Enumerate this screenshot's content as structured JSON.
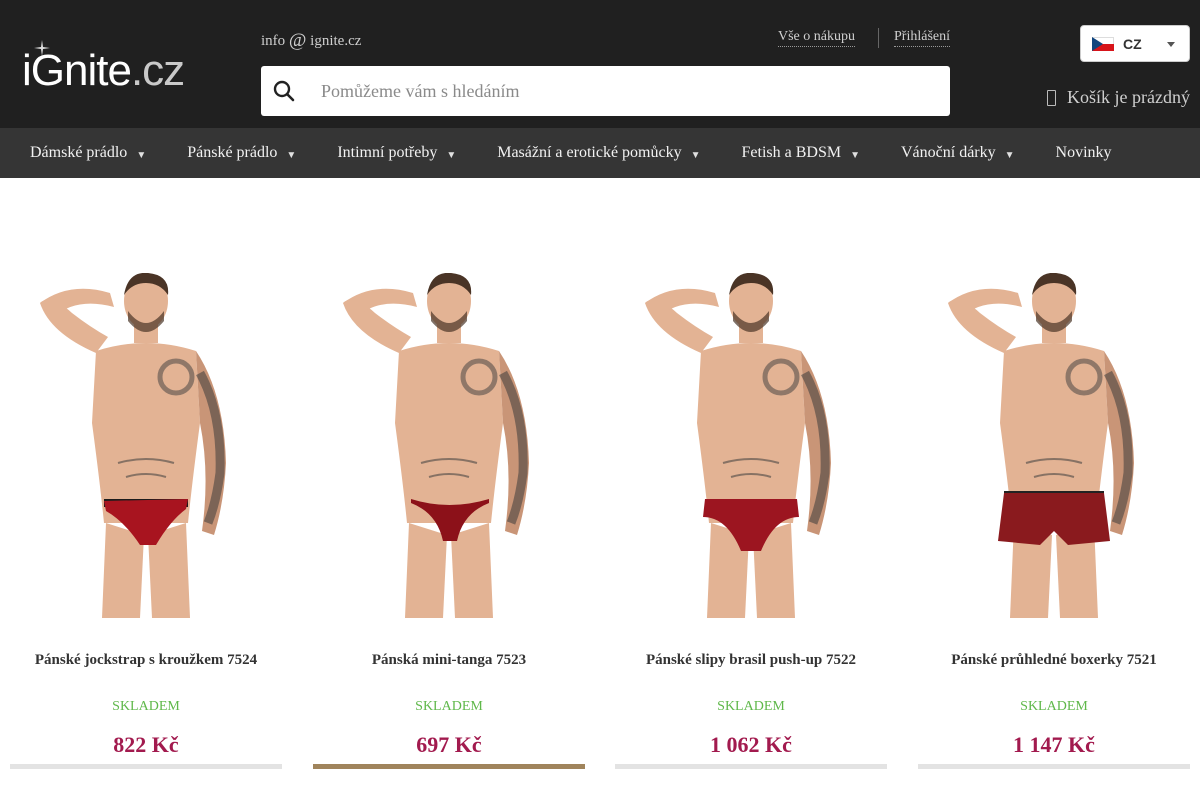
{
  "brand": {
    "logo_main": "iGnite",
    "logo_tld": ".cz"
  },
  "header": {
    "email_user": "info",
    "email_at": "@",
    "email_domain": "ignite.cz",
    "links": {
      "about": "Vše o nákupu",
      "login": "Přihlášení"
    },
    "language": {
      "code": "CZ"
    },
    "search": {
      "placeholder": "Pomůžeme vám s hledáním"
    },
    "cart": {
      "label": "Košík je prázdný"
    }
  },
  "nav": {
    "items": [
      {
        "label": "Dámské prádlo",
        "caret": "▼"
      },
      {
        "label": "Pánské prádlo",
        "caret": "▼"
      },
      {
        "label": "Intimní potřeby",
        "caret": "▼"
      },
      {
        "label": "Masážní a erotické pomůcky",
        "caret": "▼"
      },
      {
        "label": "Fetish a BDSM",
        "caret": "▼"
      },
      {
        "label": "Vánoční dárky",
        "caret": "▼"
      },
      {
        "label": "Novinky"
      }
    ]
  },
  "products": [
    {
      "name": "Pánské jockstrap s kroužkem 7524",
      "stock": "SKLADEM",
      "price": "822 Kč",
      "garment": "jockstrap",
      "garment_color": "#a8141f"
    },
    {
      "name": "Pánská mini-tanga 7523",
      "stock": "SKLADEM",
      "price": "697 Kč",
      "garment": "thong",
      "garment_color": "#8c1119"
    },
    {
      "name": "Pánské slipy brasil push-up 7522",
      "stock": "SKLADEM",
      "price": "1 062 Kč",
      "garment": "brief",
      "garment_color": "#9c1520"
    },
    {
      "name": "Pánské průhledné boxerky 7521",
      "stock": "SKLADEM",
      "price": "1 147 Kč",
      "garment": "boxer",
      "garment_color": "#8a1a1e"
    }
  ],
  "colors": {
    "header_bg": "#202020",
    "nav_bg": "#353535",
    "stock_green": "#5fb84a",
    "price": "#a21a4e",
    "active_bar": "#a0845c"
  }
}
